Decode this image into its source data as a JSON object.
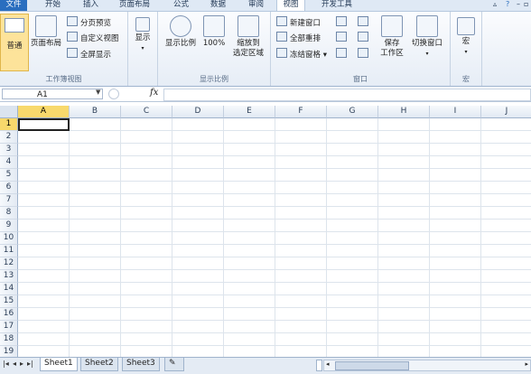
{
  "ribbon_tabs": [
    "文件",
    "开始",
    "插入",
    "页面布局",
    "公式",
    "数据",
    "审阅",
    "视图",
    "开发工具"
  ],
  "active_tab": "视图",
  "groups": {
    "workbook_views": {
      "label": "工作簿视图",
      "normal": "普通",
      "page_layout": "页面布局",
      "page_break": "分页预览",
      "custom_views": "自定义视图",
      "full_screen": "全屏显示"
    },
    "show": {
      "label": "显示"
    },
    "zoom": {
      "label": "显示比例",
      "zoom": "显示比例",
      "hundred": "100%",
      "zoom_sel_1": "缩放到",
      "zoom_sel_2": "选定区域"
    },
    "window": {
      "label": "窗口",
      "new_window": "新建窗口",
      "arrange_all": "全部重排",
      "freeze": "冻结窗格",
      "save_ws_1": "保存",
      "save_ws_2": "工作区",
      "switch_window": "切换窗口"
    },
    "macros": {
      "label": "宏",
      "macro": "宏"
    }
  },
  "formula_bar": {
    "name_box": "A1",
    "fx": "fx",
    "content": ""
  },
  "columns": [
    "A",
    "B",
    "C",
    "D",
    "E",
    "F",
    "G",
    "H",
    "I",
    "J"
  ],
  "rows": [
    "1",
    "2",
    "3",
    "4",
    "5",
    "6",
    "7",
    "8",
    "9",
    "10",
    "11",
    "12",
    "13",
    "14",
    "15",
    "16",
    "17",
    "18",
    "19"
  ],
  "active_cell": "A1",
  "sheets": [
    "Sheet1",
    "Sheet2",
    "Sheet3"
  ],
  "active_sheet": "Sheet1",
  "colors": {
    "file_tab": "#2a6ebf",
    "selected_header": "#f8d96c",
    "ribbon_bg": "#e6edf6"
  }
}
